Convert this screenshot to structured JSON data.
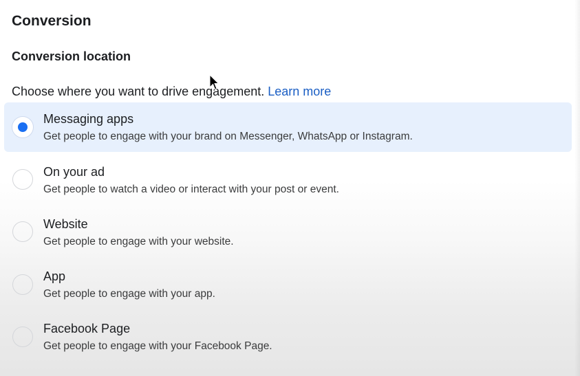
{
  "section": {
    "title": "Conversion",
    "subtitle": "Conversion location",
    "description": "Choose where you want to drive engagement.",
    "learn_more": "Learn more"
  },
  "options": [
    {
      "label": "Messaging apps",
      "description": "Get people to engage with your brand on Messenger, WhatsApp or Instagram.",
      "selected": true
    },
    {
      "label": "On your ad",
      "description": "Get people to watch a video or interact with your post or event.",
      "selected": false
    },
    {
      "label": "Website",
      "description": "Get people to engage with your website.",
      "selected": false
    },
    {
      "label": "App",
      "description": "Get people to engage with your app.",
      "selected": false
    },
    {
      "label": "Facebook Page",
      "description": "Get people to engage with your Facebook Page.",
      "selected": false
    }
  ],
  "colors": {
    "accent": "#1a6ff2",
    "link": "#1a5ec4",
    "selected_background": "#e7f0fd"
  },
  "icons": {
    "cursor": "mouse-pointer-icon"
  }
}
